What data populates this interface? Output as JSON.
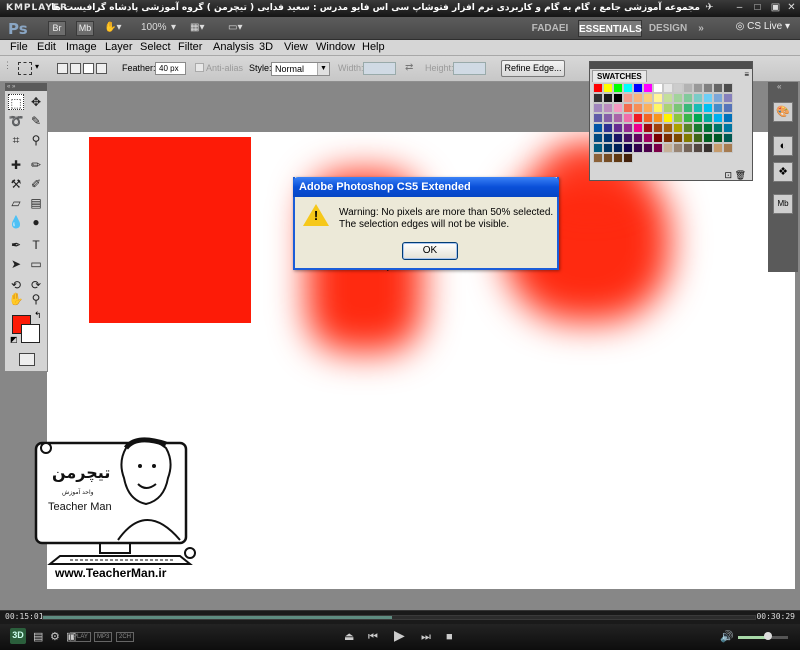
{
  "player": {
    "logo": "KMPLAYER",
    "caption": "مجموعه آموزشی جامع ، گام به گام و کاربردی نرم افزار فتوشاپ سی اس فایو  مدرس : سعید فدایی ( تیچرمن ) گروه آموزشی پادشاه گرافیست ها",
    "time_current": "00:15:01",
    "time_total": "00:30:29",
    "progress": 0.49,
    "volume": 0.6,
    "badges": [
      "PLAY",
      "MP3",
      "2CH"
    ],
    "mode_3d": "3D"
  },
  "appbar": {
    "logo": "Ps",
    "br_label": "Br",
    "mb_label": "Mb",
    "zoom": "100%",
    "workspaces": [
      "FADAEI",
      "ESSENTIALS",
      "DESIGN"
    ],
    "more": "»",
    "cs_live": "CS Live"
  },
  "menu": [
    "File",
    "Edit",
    "Image",
    "Layer",
    "Select",
    "Filter",
    "Analysis",
    "3D",
    "View",
    "Window",
    "Help"
  ],
  "options": {
    "feather_label": "Feather:",
    "feather_value": "40 px",
    "antialias_label": "Anti-alias",
    "style_label": "Style:",
    "style_value": "Normal",
    "width_label": "Width:",
    "height_label": "Height:",
    "refine_edge": "Refine Edge..."
  },
  "swatches": {
    "title": "SWATCHES",
    "rows": [
      [
        "#ff0000",
        "#ffff00",
        "#00ff00",
        "#00ffff",
        "#0000ff",
        "#ff00ff",
        "#ffffff",
        "#e6e6e6",
        "#cccccc",
        "#b3b3b3",
        "#999999",
        "#808080",
        "#666666",
        "#4d4d4d"
      ],
      [
        "#333333",
        "#1a1a1a",
        "#000000",
        "#f29d8d",
        "#f7b47e",
        "#fbd07c",
        "#fff699",
        "#c4df9b",
        "#a3d39c",
        "#82ca9c",
        "#7accc8",
        "#6dcff6",
        "#7da7d9",
        "#8781bd"
      ],
      [
        "#a187be",
        "#bc8dbf",
        "#f49ac1",
        "#f26c4f",
        "#f68e56",
        "#fbaf5d",
        "#fff568",
        "#acd373",
        "#7cc576",
        "#3bb878",
        "#1abbb4",
        "#00bff3",
        "#448ccb",
        "#5674b9"
      ],
      [
        "#605ca8",
        "#855fa8",
        "#a864a8",
        "#f06eaa",
        "#ed1c24",
        "#f26522",
        "#f7941d",
        "#fff200",
        "#8dc63f",
        "#39b54a",
        "#00a651",
        "#00a99d",
        "#00aeef",
        "#0072bc"
      ],
      [
        "#0054a6",
        "#2e3192",
        "#662d91",
        "#92278f",
        "#ec008c",
        "#9e0b0f",
        "#a0410d",
        "#a3620a",
        "#aba000",
        "#598527",
        "#197b30",
        "#007236",
        "#00746b",
        "#0076a3"
      ],
      [
        "#004a80",
        "#003471",
        "#1b1464",
        "#440e62",
        "#630460",
        "#9e005d",
        "#790000",
        "#7b2e00",
        "#7d4900",
        "#827b00",
        "#406618",
        "#005e20",
        "#005826",
        "#005952"
      ],
      [
        "#005b7f",
        "#003663",
        "#002157",
        "#0d004c",
        "#32004b",
        "#4b0049",
        "#7b0046",
        "#c7b299",
        "#998675",
        "#736357",
        "#534741",
        "#37302d",
        "#c69c6d",
        "#a67c52"
      ],
      [
        "#8c6239",
        "#754c24",
        "#603913",
        "#42210b"
      ]
    ]
  },
  "dialog": {
    "title": "Adobe Photoshop CS5 Extended",
    "line1": "Warning: No pixels are more than 50% selected.",
    "line2": "The selection edges will not be visible.",
    "ok": "OK"
  },
  "watermark": {
    "brand_fa": "تیچرمن",
    "subtitle_fa": "واحد آموزش",
    "brand_en": "Teacher Man",
    "url": "www.TeacherMan.ir"
  },
  "colors": {
    "red_fill": "#fd1b07",
    "xp_blue": "#0a50d8",
    "dialog_bg": "#ece9d8"
  }
}
